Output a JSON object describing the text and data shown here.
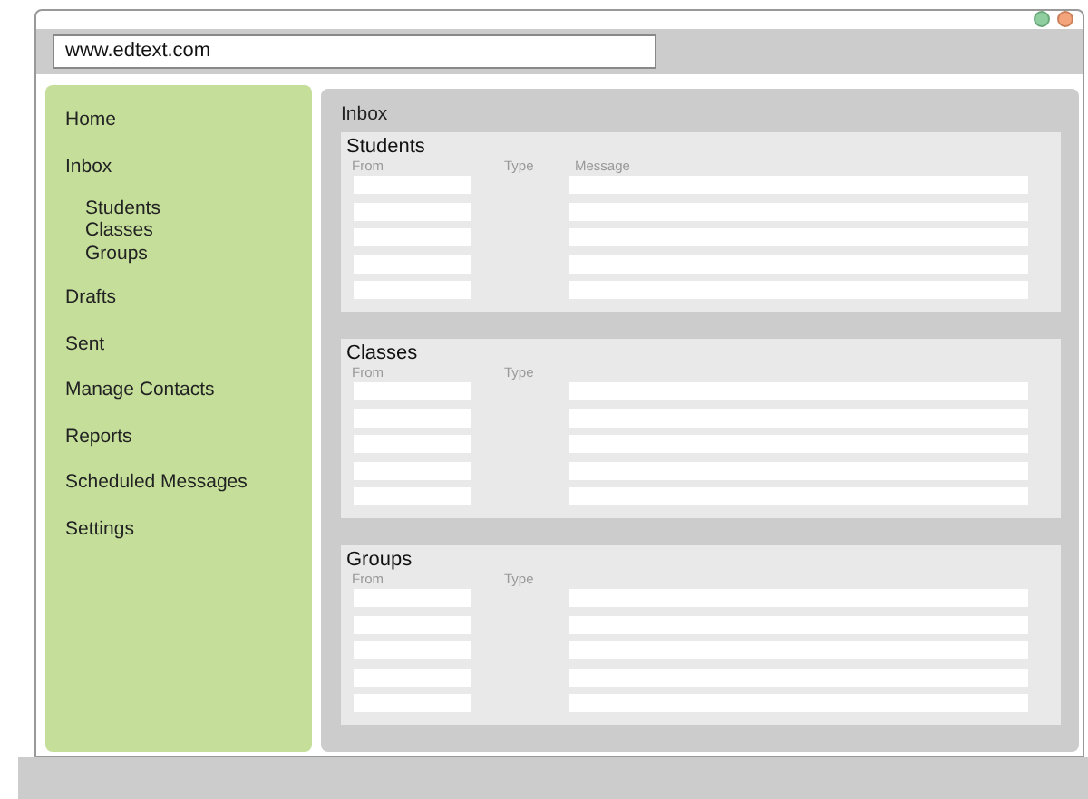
{
  "address_bar": {
    "url": "www.edtext.com"
  },
  "sidebar": {
    "items": [
      {
        "label": "Home"
      },
      {
        "label": "Inbox",
        "children": [
          {
            "label": "Students"
          },
          {
            "label": "Classes"
          },
          {
            "label": "Groups"
          }
        ]
      },
      {
        "label": "Drafts"
      },
      {
        "label": "Sent"
      },
      {
        "label": "Manage Contacts"
      },
      {
        "label": "Reports"
      },
      {
        "label": "Scheduled Messages"
      },
      {
        "label": "Settings"
      }
    ]
  },
  "main": {
    "title": "Inbox",
    "sections": [
      {
        "title": "Students",
        "columns": [
          "From",
          "Type",
          "Message"
        ]
      },
      {
        "title": "Classes",
        "columns": [
          "From",
          "Type"
        ]
      },
      {
        "title": "Groups",
        "columns": [
          "From",
          "Type"
        ]
      }
    ]
  }
}
